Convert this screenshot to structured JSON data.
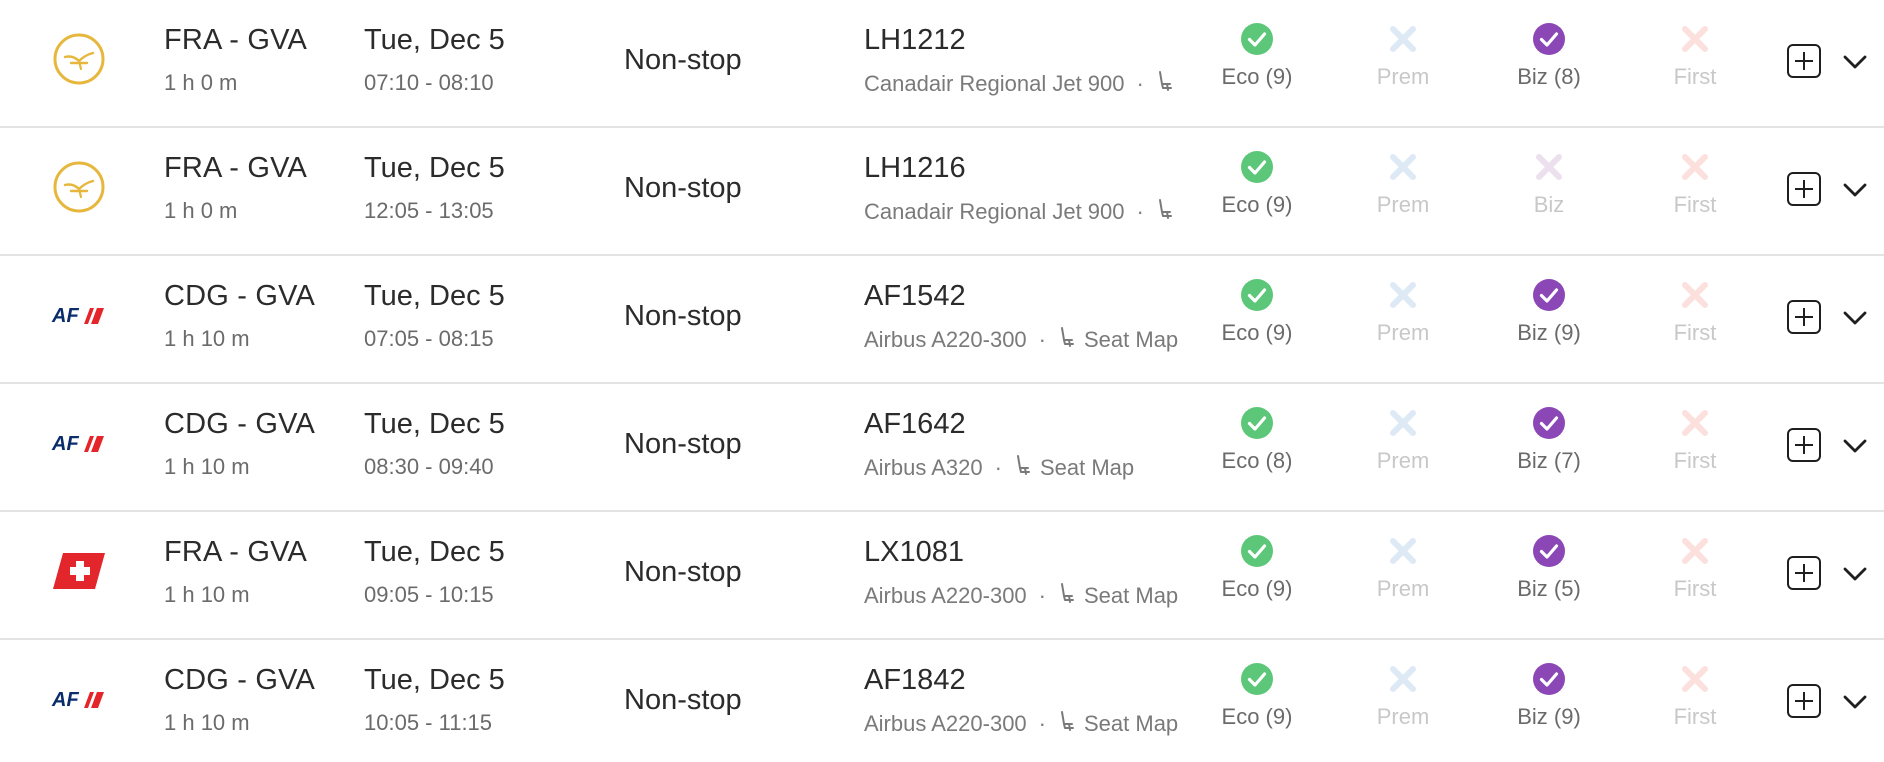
{
  "colors": {
    "eco_available": "#5cc779",
    "biz_available": "#8a47b5",
    "prem_unavailable": "#dde9f5",
    "biz_unavailable": "#ece0ef",
    "first_unavailable": "#fbe0dd",
    "lufthansa_gold": "#e6b73c",
    "airfrance_navy": "#0b2d6b",
    "airfrance_red": "#e4262b",
    "swiss_red": "#e3262b"
  },
  "rows": [
    {
      "airline": "lufthansa",
      "route": "FRA - GVA",
      "duration": "1 h 0 m",
      "date": "Tue, Dec 5",
      "times": "07:10 - 08:10",
      "stops": "Non-stop",
      "flight": "LH1212",
      "aircraft": "Canadair Regional Jet 900",
      "seat_map": "",
      "eco": "Eco (9)",
      "prem": "Prem",
      "biz": "Biz (8)",
      "first": "First"
    },
    {
      "airline": "lufthansa",
      "route": "FRA - GVA",
      "duration": "1 h 0 m",
      "date": "Tue, Dec 5",
      "times": "12:05 - 13:05",
      "stops": "Non-stop",
      "flight": "LH1216",
      "aircraft": "Canadair Regional Jet 900",
      "seat_map": "",
      "eco": "Eco (9)",
      "prem": "Prem",
      "biz": "Biz",
      "first": "First"
    },
    {
      "airline": "airfrance",
      "route": "CDG - GVA",
      "duration": "1 h 10 m",
      "date": "Tue, Dec 5",
      "times": "07:05 - 08:15",
      "stops": "Non-stop",
      "flight": "AF1542",
      "aircraft": "Airbus A220-300",
      "seat_map": "Seat Map",
      "eco": "Eco (9)",
      "prem": "Prem",
      "biz": "Biz (9)",
      "first": "First"
    },
    {
      "airline": "airfrance",
      "route": "CDG - GVA",
      "duration": "1 h 10 m",
      "date": "Tue, Dec 5",
      "times": "08:30 - 09:40",
      "stops": "Non-stop",
      "flight": "AF1642",
      "aircraft": "Airbus A320",
      "seat_map": "Seat Map",
      "eco": "Eco (8)",
      "prem": "Prem",
      "biz": "Biz (7)",
      "first": "First"
    },
    {
      "airline": "swiss",
      "route": "FRA - GVA",
      "duration": "1 h 10 m",
      "date": "Tue, Dec 5",
      "times": "09:05 - 10:15",
      "stops": "Non-stop",
      "flight": "LX1081",
      "aircraft": "Airbus A220-300",
      "seat_map": "Seat Map",
      "eco": "Eco (9)",
      "prem": "Prem",
      "biz": "Biz (5)",
      "first": "First"
    },
    {
      "airline": "airfrance",
      "route": "CDG - GVA",
      "duration": "1 h 10 m",
      "date": "Tue, Dec 5",
      "times": "10:05 - 11:15",
      "stops": "Non-stop",
      "flight": "AF1842",
      "aircraft": "Airbus A220-300",
      "seat_map": "Seat Map",
      "eco": "Eco (9)",
      "prem": "Prem",
      "biz": "Biz (9)",
      "first": "First"
    }
  ]
}
